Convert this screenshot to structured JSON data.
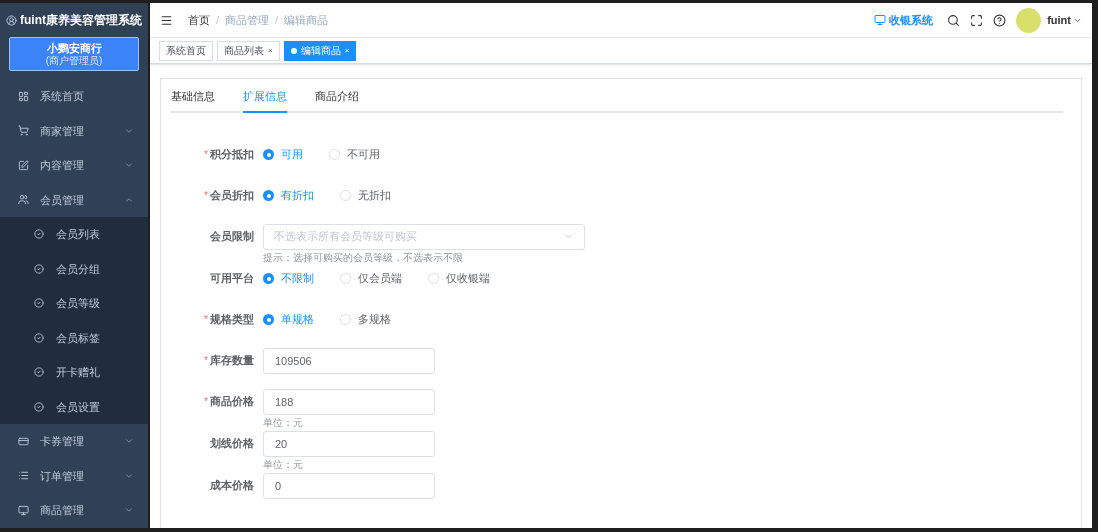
{
  "app": {
    "title": "fuint康养美容管理系统"
  },
  "merchant": {
    "name": "小鹦安商行",
    "role": "(商户管理员)"
  },
  "sidebar": {
    "items": [
      {
        "label": "系统首页",
        "has_children": false
      },
      {
        "label": "商家管理",
        "expanded": false,
        "has_children": true
      },
      {
        "label": "内容管理",
        "expanded": false,
        "has_children": true
      },
      {
        "label": "会员管理",
        "expanded": true,
        "has_children": true,
        "children": [
          {
            "label": "会员列表"
          },
          {
            "label": "会员分组"
          },
          {
            "label": "会员等级"
          },
          {
            "label": "会员标签"
          },
          {
            "label": "开卡赠礼"
          },
          {
            "label": "会员设置"
          }
        ]
      },
      {
        "label": "卡券管理",
        "expanded": false,
        "has_children": true
      },
      {
        "label": "订单管理",
        "expanded": false,
        "has_children": true
      },
      {
        "label": "商品管理",
        "expanded": false,
        "has_children": true
      }
    ]
  },
  "breadcrumb": [
    "首页",
    "商品管理",
    "编辑商品"
  ],
  "breadcrumb_separator": "/",
  "required_mark": "*",
  "header": {
    "cashier": "收银系统",
    "user": "fuint"
  },
  "tags": [
    {
      "label": "系统首页",
      "selected": false,
      "closable": false
    },
    {
      "label": "商品列表",
      "selected": false,
      "closable": true
    },
    {
      "label": "编辑商品",
      "selected": true,
      "closable": true
    }
  ],
  "close_mark": "×",
  "tabs": [
    {
      "label": "基础信息",
      "selected": false
    },
    {
      "label": "扩展信息",
      "selected": true
    },
    {
      "label": "商品介绍",
      "selected": false
    }
  ],
  "form": [
    {
      "kind": "radio",
      "label": "积分抵扣",
      "required": true,
      "options": [
        {
          "label": "可用",
          "selected": true
        },
        {
          "label": "不可用",
          "selected": false
        }
      ]
    },
    {
      "kind": "radio",
      "label": "会员折扣",
      "required": true,
      "options": [
        {
          "label": "有折扣",
          "selected": true
        },
        {
          "label": "无折扣",
          "selected": false
        }
      ]
    },
    {
      "kind": "select",
      "label": "会员限制",
      "required": false,
      "placeholder": "不选表示所有会员等级可购买",
      "hint": "提示：选择可购买的会员等级，不选表示不限"
    },
    {
      "kind": "radio",
      "label": "可用平台",
      "required": false,
      "options": [
        {
          "label": "不限制",
          "selected": true
        },
        {
          "label": "仅会员端",
          "selected": false
        },
        {
          "label": "仅收银端",
          "selected": false
        }
      ]
    },
    {
      "kind": "radio",
      "label": "规格类型",
      "required": true,
      "options": [
        {
          "label": "单规格",
          "selected": true
        },
        {
          "label": "多规格",
          "selected": false
        }
      ]
    },
    {
      "kind": "input",
      "label": "库存数量",
      "required": true,
      "value": "109506"
    },
    {
      "kind": "input",
      "label": "商品价格",
      "required": true,
      "value": "188",
      "hint": "单位：元"
    },
    {
      "kind": "input",
      "label": "划线价格",
      "required": false,
      "value": "20",
      "hint": "单位：元"
    },
    {
      "kind": "input",
      "label": "成本价格",
      "required": false,
      "value": "0"
    }
  ]
}
